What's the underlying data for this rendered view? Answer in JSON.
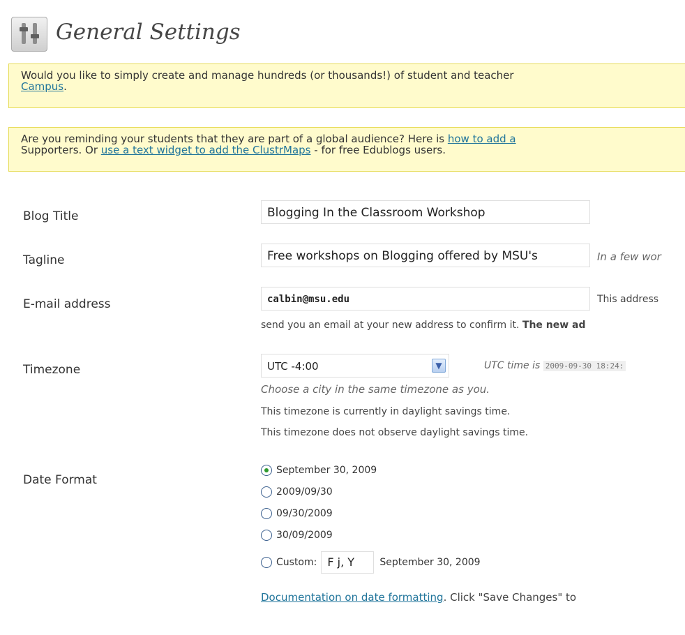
{
  "header": {
    "title": "General Settings",
    "icon": "settings-sliders-icon"
  },
  "notices": [
    {
      "line1": "Would you like to simply create and manage hundreds (or thousands!) of student and teacher",
      "link": "Campus",
      "after_link": "."
    },
    {
      "line1_before": "Are you reminding your students that they are part of a global audience? Here is ",
      "line1_link": "how to add a",
      "line2_before": "Supporters. Or ",
      "line2_link": "use a text widget to add the ClustrMaps",
      "line2_after": " - for free Edublogs users."
    }
  ],
  "form": {
    "blog_title": {
      "label": "Blog Title",
      "value": "Blogging In the Classroom Workshop"
    },
    "tagline": {
      "label": "Tagline",
      "value": "Free workshops on Blogging offered by MSU's",
      "hint": "In a few wor"
    },
    "email": {
      "label": "E-mail address",
      "value": "calbin@msu.edu",
      "hint": "This address",
      "note": "send you an email at your new address to confirm it. ",
      "note_bold": "The new ad"
    },
    "timezone": {
      "label": "Timezone",
      "selected": "UTC -4:00",
      "utc_label": "UTC time is",
      "utc_value": "2009-09-30 18:24:",
      "hint": "Choose a city in the same timezone as you.",
      "dst_note": "This timezone is currently in daylight savings time.",
      "observe_note": "This timezone does not observe daylight savings time."
    },
    "date_format": {
      "label": "Date Format",
      "options": [
        "September 30, 2009",
        "2009/09/30",
        "09/30/2009",
        "30/09/2009"
      ],
      "custom_label": "Custom:",
      "custom_value": "F j, Y",
      "custom_preview": "September 30, 2009",
      "doc_link": "Documentation on date formatting",
      "doc_after": ". Click \"Save Changes\" to"
    }
  },
  "colors": {
    "notice_bg": "#fffbcc",
    "notice_border": "#e6db55",
    "link": "#21759b",
    "radio_checked": "#2d9a2d"
  }
}
